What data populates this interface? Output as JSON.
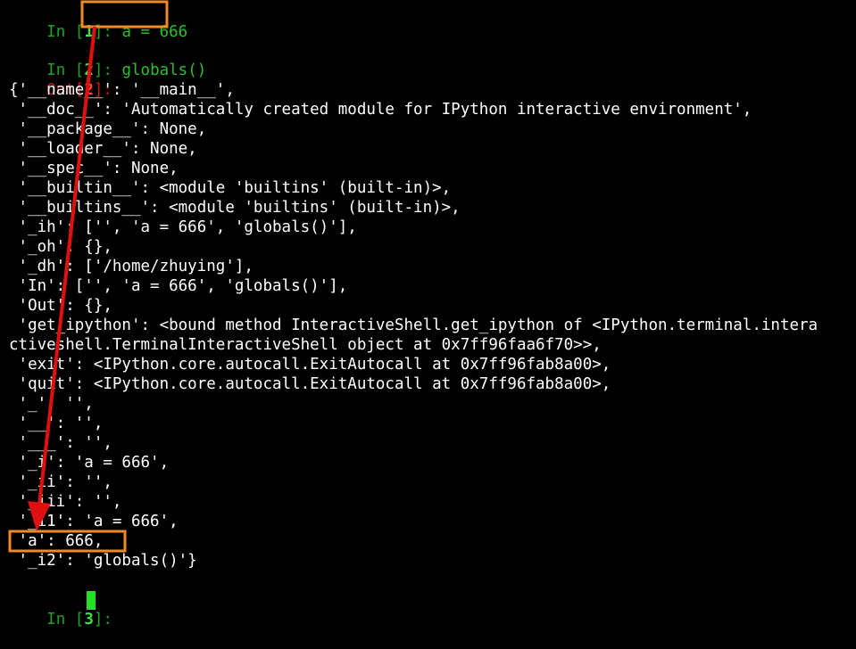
{
  "colors": {
    "background": "#000000",
    "text": "#ffffff",
    "in_prompt": "#1ea51e",
    "out_prompt": "#c11e1e",
    "cursor": "#22e022",
    "highlight": "#f08a24",
    "arrow": "#e01010"
  },
  "cells": {
    "in1": {
      "prefix": "In [",
      "num": "1",
      "suffix": "]: ",
      "code": "a = 666"
    },
    "in2": {
      "prefix": "In [",
      "num": "2",
      "suffix": "]: ",
      "code": "globals()"
    },
    "out2": {
      "prefix": "Out[",
      "num": "2",
      "suffix": "]:"
    },
    "in3": {
      "prefix": "In [",
      "num": "3",
      "suffix": "]: "
    }
  },
  "output_lines": [
    "{'__name__': '__main__',",
    " '__doc__': 'Automatically created module for IPython interactive environment',",
    " '__package__': None,",
    " '__loader__': None,",
    " '__spec__': None,",
    " '__builtin__': <module 'builtins' (built-in)>,",
    " '__builtins__': <module 'builtins' (built-in)>,",
    " '_ih': ['', 'a = 666', 'globals()'],",
    " '_oh': {},",
    " '_dh': ['/home/zhuying'],",
    " 'In': ['', 'a = 666', 'globals()'],",
    " 'Out': {},",
    " 'get_ipython': <bound method InteractiveShell.get_ipython of <IPython.terminal.intera",
    "ctiveshell.TerminalInteractiveShell object at 0x7ff96faa6f70>>,",
    " 'exit': <IPython.core.autocall.ExitAutocall at 0x7ff96fab8a00>,",
    " 'quit': <IPython.core.autocall.ExitAutocall at 0x7ff96fab8a00>,",
    " '_': '',",
    " '__': '',",
    " '___': '',",
    " '_i': 'a = 666',",
    " '_ii': '',",
    " '_iii': '',",
    " '_i1': 'a = 666',",
    " 'a': 666,",
    " '_i2': 'globals()'}"
  ]
}
